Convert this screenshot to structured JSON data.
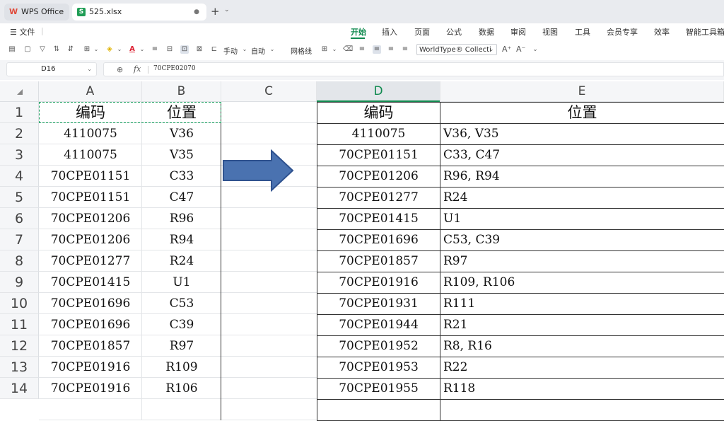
{
  "tabs": {
    "app_name": "WPS Office",
    "file_name": "525.xlsx",
    "modified_dot": "●",
    "new_tab": "+",
    "new_tab_chevron": "⌄"
  },
  "menu": {
    "file": "☰ 文件",
    "items": [
      "开始",
      "插入",
      "页面",
      "公式",
      "数据",
      "审阅",
      "视图",
      "工具",
      "会员专享",
      "效率",
      "智能工具箱"
    ],
    "active": "开始"
  },
  "toolbar": {
    "row_height_label": "手动",
    "col_width_label": "自动",
    "gridlines_label": "网格线",
    "font_name": "WorldType® Collecti",
    "icons": [
      "paste-special-icon",
      "format-painter-icon",
      "filter-icon",
      "sort-asc-icon",
      "sort-desc-icon",
      "border-icon",
      "fill-color-icon",
      "font-color-icon",
      "wrap-icon",
      "freeze-icon",
      "merge-center-icon",
      "table-style-icon",
      "split-icon",
      "row-height-icon",
      "col-width-icon",
      "gridlines-checkbox",
      "cell-style-icon",
      "clear-format-icon",
      "align-left-icon",
      "align-center-icon",
      "align-right-icon",
      "justify-icon",
      "font-grow-icon",
      "font-shrink-icon"
    ]
  },
  "formula_bar": {
    "cell_ref": "D16",
    "fx": "fx",
    "value": "70CPE02070"
  },
  "columns": [
    "A",
    "B",
    "C",
    "D",
    "E"
  ],
  "selected_column": "D",
  "rows": [
    "1",
    "2",
    "3",
    "4",
    "5",
    "6",
    "7",
    "8",
    "9",
    "10",
    "11",
    "12",
    "13",
    "14"
  ],
  "left_table": {
    "headers": [
      "编码",
      "位置"
    ],
    "rows": [
      [
        "4110075",
        "V36"
      ],
      [
        "4110075",
        "V35"
      ],
      [
        "70CPE01151",
        "C33"
      ],
      [
        "70CPE01151",
        "C47"
      ],
      [
        "70CPE01206",
        "R96"
      ],
      [
        "70CPE01206",
        "R94"
      ],
      [
        "70CPE01277",
        "R24"
      ],
      [
        "70CPE01415",
        "U1"
      ],
      [
        "70CPE01696",
        "C53"
      ],
      [
        "70CPE01696",
        "C39"
      ],
      [
        "70CPE01857",
        "R97"
      ],
      [
        "70CPE01916",
        "R109"
      ],
      [
        "70CPE01916",
        "R106"
      ]
    ]
  },
  "right_table": {
    "headers": [
      "编码",
      "位置"
    ],
    "rows": [
      [
        "4110075",
        "V36, V35"
      ],
      [
        "70CPE01151",
        "C33, C47"
      ],
      [
        "70CPE01206",
        "R96, R94"
      ],
      [
        "70CPE01277",
        "R24"
      ],
      [
        "70CPE01415",
        "U1"
      ],
      [
        "70CPE01696",
        "C53, C39"
      ],
      [
        "70CPE01857",
        "R97"
      ],
      [
        "70CPE01916",
        "R109, R106"
      ],
      [
        "70CPE01931",
        "R111"
      ],
      [
        "70CPE01944",
        "R21"
      ],
      [
        "70CPE01952",
        "R8, R16"
      ],
      [
        "70CPE01953",
        "R22"
      ],
      [
        "70CPE01955",
        "R118"
      ]
    ]
  },
  "colors": {
    "accent": "#108a4f",
    "arrow_fill": "#4a72b0",
    "arrow_stroke": "#2f528f"
  }
}
